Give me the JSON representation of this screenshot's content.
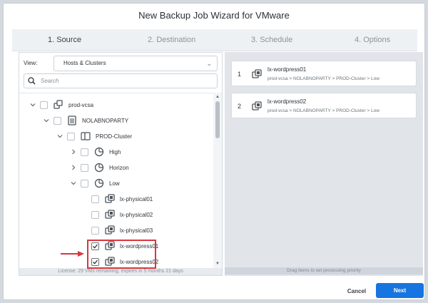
{
  "dialog": {
    "title": "New Backup Job Wizard for VMware"
  },
  "steps": [
    {
      "label": "1. Source",
      "active": true
    },
    {
      "label": "2. Destination",
      "active": false
    },
    {
      "label": "3. Schedule",
      "active": false
    },
    {
      "label": "4. Options",
      "active": false
    }
  ],
  "source": {
    "view_label": "View:",
    "view_value": "Hosts & Clusters",
    "search_placeholder": "Search",
    "tree": [
      {
        "label": "prod-vcsa",
        "icon": "vcenter-icon",
        "expanded": true,
        "checked": false
      },
      {
        "label": "NOLABNOPARTY",
        "icon": "datacenter-icon",
        "expanded": true,
        "checked": false
      },
      {
        "label": "PROD-Cluster",
        "icon": "cluster-icon",
        "expanded": true,
        "checked": false
      },
      {
        "label": "High",
        "icon": "resource-pool-icon",
        "expanded": false,
        "checked": false
      },
      {
        "label": "Horizon",
        "icon": "resource-pool-icon",
        "expanded": false,
        "checked": false
      },
      {
        "label": "Low",
        "icon": "resource-pool-icon",
        "expanded": true,
        "checked": false
      },
      {
        "label": "lx-physical01",
        "icon": "vm-icon",
        "checked": false
      },
      {
        "label": "lx-physical02",
        "icon": "vm-icon",
        "checked": false
      },
      {
        "label": "lx-physical03",
        "icon": "vm-icon",
        "checked": false
      },
      {
        "label": "lx-wordpress01",
        "icon": "vm-icon",
        "checked": true
      },
      {
        "label": "lx-wordpress02",
        "icon": "vm-icon",
        "checked": true
      }
    ],
    "license": "License: 29 VMs remaining; expires in 5 months 21 days"
  },
  "selected": {
    "items": [
      {
        "num": "1",
        "name": "lx-wordpress01",
        "path": "prod-vcsa > NOLABNOPARTY > PROD-Cluster > Low"
      },
      {
        "num": "2",
        "name": "lx-wordpress02",
        "path": "prod-vcsa > NOLABNOPARTY > PROD-Cluster > Low"
      }
    ],
    "footer": "Drag items to set processing priority"
  },
  "buttons": {
    "cancel": "Cancel",
    "next": "Next"
  },
  "colors": {
    "accent": "#1675e0",
    "highlight": "#d9363e"
  }
}
